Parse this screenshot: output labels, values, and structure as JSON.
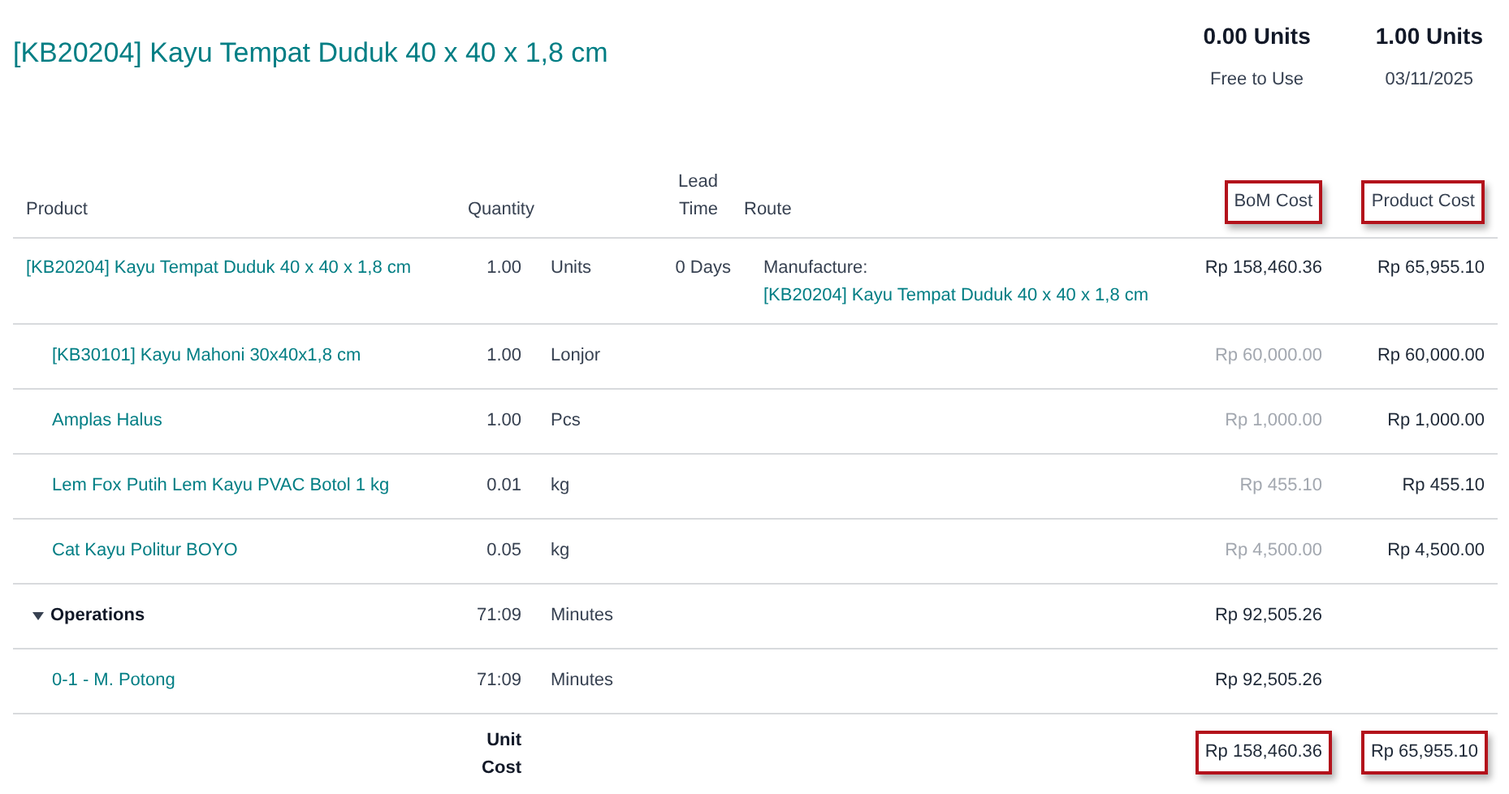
{
  "title": "[KB20204] Kayu Tempat Duduk 40 x 40 x 1,8 cm",
  "stats": [
    {
      "value": "0.00 Units",
      "label": "Free to Use"
    },
    {
      "value": "1.00 Units",
      "label": "03/11/2025"
    }
  ],
  "columns": [
    {
      "label": "Product",
      "highlighted": false
    },
    {
      "label": "Quantity",
      "highlighted": false
    },
    {
      "label": "Lead Time",
      "highlighted": false
    },
    {
      "label": "Route",
      "highlighted": false
    },
    {
      "label": "BoM Cost",
      "highlighted": true
    },
    {
      "label": "Product Cost",
      "highlighted": true
    }
  ],
  "rows": [
    {
      "kind": "product",
      "name": "[KB20204] Kayu Tempat Duduk 40 x 40 x 1,8 cm",
      "quantity": "1.00",
      "unit": "Units",
      "lead_time": "0 Days",
      "route_label": "Manufacture:",
      "route_link": "[KB20204] Kayu Tempat Duduk 40 x 40 x 1,8 cm",
      "bom_cost": "Rp 158,460.36",
      "bom_cost_dimmed": false,
      "product_cost": "Rp 65,955.10"
    },
    {
      "kind": "component",
      "name": "[KB30101] Kayu Mahoni 30x40x1,8 cm",
      "quantity": "1.00",
      "unit": "Lonjor",
      "bom_cost": "Rp 60,000.00",
      "bom_cost_dimmed": true,
      "product_cost": "Rp 60,000.00"
    },
    {
      "kind": "component",
      "name": "Amplas Halus",
      "quantity": "1.00",
      "unit": "Pcs",
      "bom_cost": "Rp 1,000.00",
      "bom_cost_dimmed": true,
      "product_cost": "Rp 1,000.00"
    },
    {
      "kind": "component",
      "name": "Lem Fox Putih Lem Kayu PVAC Botol 1 kg",
      "quantity": "0.01",
      "unit": "kg",
      "bom_cost": "Rp 455.10",
      "bom_cost_dimmed": true,
      "product_cost": "Rp 455.10"
    },
    {
      "kind": "component",
      "name": "Cat Kayu Politur BOYO",
      "quantity": "0.05",
      "unit": "kg",
      "bom_cost": "Rp 4,500.00",
      "bom_cost_dimmed": true,
      "product_cost": "Rp 4,500.00"
    },
    {
      "kind": "operations",
      "name": "Operations",
      "expanded": true,
      "quantity": "71:09",
      "unit": "Minutes",
      "bom_cost": "Rp 92,505.26",
      "bom_cost_dimmed": false
    },
    {
      "kind": "operation",
      "name": "0-1 - M. Potong",
      "quantity": "71:09",
      "unit": "Minutes",
      "bom_cost": "Rp 92,505.26",
      "bom_cost_dimmed": false
    }
  ],
  "footer": {
    "label": "Unit Cost",
    "bom_cost": "Rp 158,460.36",
    "bom_cost_highlighted": true,
    "product_cost": "Rp 65,955.10",
    "product_cost_highlighted": true
  }
}
